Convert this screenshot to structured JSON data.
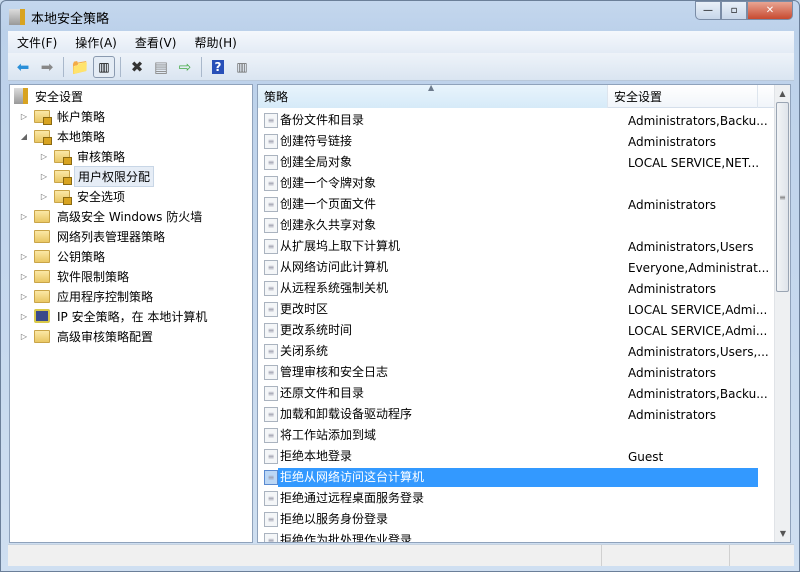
{
  "window": {
    "title": "本地安全策略",
    "min": "—",
    "max": "▫",
    "close": "✕"
  },
  "menu": [
    "文件(F)",
    "操作(A)",
    "查看(V)",
    "帮助(H)"
  ],
  "tree": [
    {
      "label": "安全设置",
      "level": 0,
      "tw": "",
      "icon": "security-settings"
    },
    {
      "label": "帐户策略",
      "level": 1,
      "tw": "▷",
      "icon": "folder-lock"
    },
    {
      "label": "本地策略",
      "level": 1,
      "tw": "◢",
      "icon": "folder-lock"
    },
    {
      "label": "审核策略",
      "level": 2,
      "tw": "▷",
      "icon": "folder-lock"
    },
    {
      "label": "用户权限分配",
      "level": 2,
      "tw": "▷",
      "icon": "folder-lock",
      "selected": true
    },
    {
      "label": "安全选项",
      "level": 2,
      "tw": "▷",
      "icon": "folder-lock"
    },
    {
      "label": "高级安全 Windows 防火墙",
      "level": 1,
      "tw": "▷",
      "icon": "folder"
    },
    {
      "label": "网络列表管理器策略",
      "level": 1,
      "tw": "",
      "icon": "folder"
    },
    {
      "label": "公钥策略",
      "level": 1,
      "tw": "▷",
      "icon": "folder"
    },
    {
      "label": "软件限制策略",
      "level": 1,
      "tw": "▷",
      "icon": "folder"
    },
    {
      "label": "应用程序控制策略",
      "level": 1,
      "tw": "▷",
      "icon": "folder"
    },
    {
      "label": "IP 安全策略，在 本地计算机",
      "level": 1,
      "tw": "▷",
      "icon": "ip-security"
    },
    {
      "label": "高级审核策略配置",
      "level": 1,
      "tw": "▷",
      "icon": "folder"
    }
  ],
  "list": {
    "columns": [
      "策略",
      "安全设置"
    ],
    "rows": [
      {
        "policy": "备份文件和目录",
        "setting": "Administrators,Backu..."
      },
      {
        "policy": "创建符号链接",
        "setting": "Administrators"
      },
      {
        "policy": "创建全局对象",
        "setting": "LOCAL SERVICE,NET..."
      },
      {
        "policy": "创建一个令牌对象",
        "setting": ""
      },
      {
        "policy": "创建一个页面文件",
        "setting": "Administrators"
      },
      {
        "policy": "创建永久共享对象",
        "setting": ""
      },
      {
        "policy": "从扩展坞上取下计算机",
        "setting": "Administrators,Users"
      },
      {
        "policy": "从网络访问此计算机",
        "setting": "Everyone,Administrat..."
      },
      {
        "policy": "从远程系统强制关机",
        "setting": "Administrators"
      },
      {
        "policy": "更改时区",
        "setting": "LOCAL SERVICE,Admi..."
      },
      {
        "policy": "更改系统时间",
        "setting": "LOCAL SERVICE,Admi..."
      },
      {
        "policy": "关闭系统",
        "setting": "Administrators,Users,..."
      },
      {
        "policy": "管理审核和安全日志",
        "setting": "Administrators"
      },
      {
        "policy": "还原文件和目录",
        "setting": "Administrators,Backu..."
      },
      {
        "policy": "加载和卸载设备驱动程序",
        "setting": "Administrators"
      },
      {
        "policy": "将工作站添加到域",
        "setting": ""
      },
      {
        "policy": "拒绝本地登录",
        "setting": "Guest"
      },
      {
        "policy": "拒绝从网络访问这台计算机",
        "setting": "",
        "selected": true
      },
      {
        "policy": "拒绝通过远程桌面服务登录",
        "setting": ""
      },
      {
        "policy": "拒绝以服务身份登录",
        "setting": ""
      },
      {
        "policy": "拒绝作为批处理作业登录",
        "setting": ""
      }
    ]
  },
  "colors": {
    "selection": "#3399ff"
  }
}
